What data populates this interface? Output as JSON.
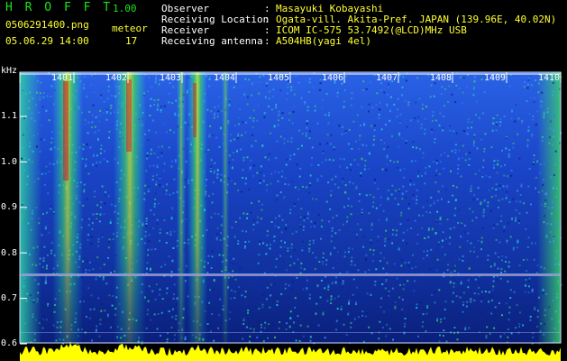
{
  "header": {
    "app_title": "H R O F F T",
    "version": "1.00",
    "filename": "0506291400.png",
    "datetime": "05.06.29 14:00",
    "meteor_label": "meteor",
    "meteor_count": "17",
    "fields": [
      {
        "label": "Observer",
        "sep": ":",
        "value": "Masayuki Kobayashi"
      },
      {
        "label": "Receiving Location",
        "sep": ":",
        "value": "Ogata-vill. Akita-Pref. JAPAN (139.96E, 40.02N)"
      },
      {
        "label": "Receiver",
        "sep": ":",
        "value": "ICOM IC-575 53.7492(@LCD)MHz USB"
      },
      {
        "label": "Receiving antenna",
        "sep": ":",
        "value": "A504HB(yagi 4el)"
      }
    ]
  },
  "spectrogram": {
    "y_unit": "kHz",
    "y_ticks": [
      "1.1",
      "1.0",
      "0.9",
      "0.8",
      "0.7",
      "0.6"
    ],
    "minute_labels": [
      "1401",
      "1402",
      "1403",
      "1404",
      "1405",
      "1406",
      "1407",
      "1408",
      "1409",
      "1410"
    ],
    "colors": {
      "deep": "#0a1a8c",
      "mid": "#1f5fe0",
      "cyan": "#22d0d8",
      "green": "#3ad06a",
      "yellow": "#ffff00",
      "red": "#d82020"
    }
  }
}
